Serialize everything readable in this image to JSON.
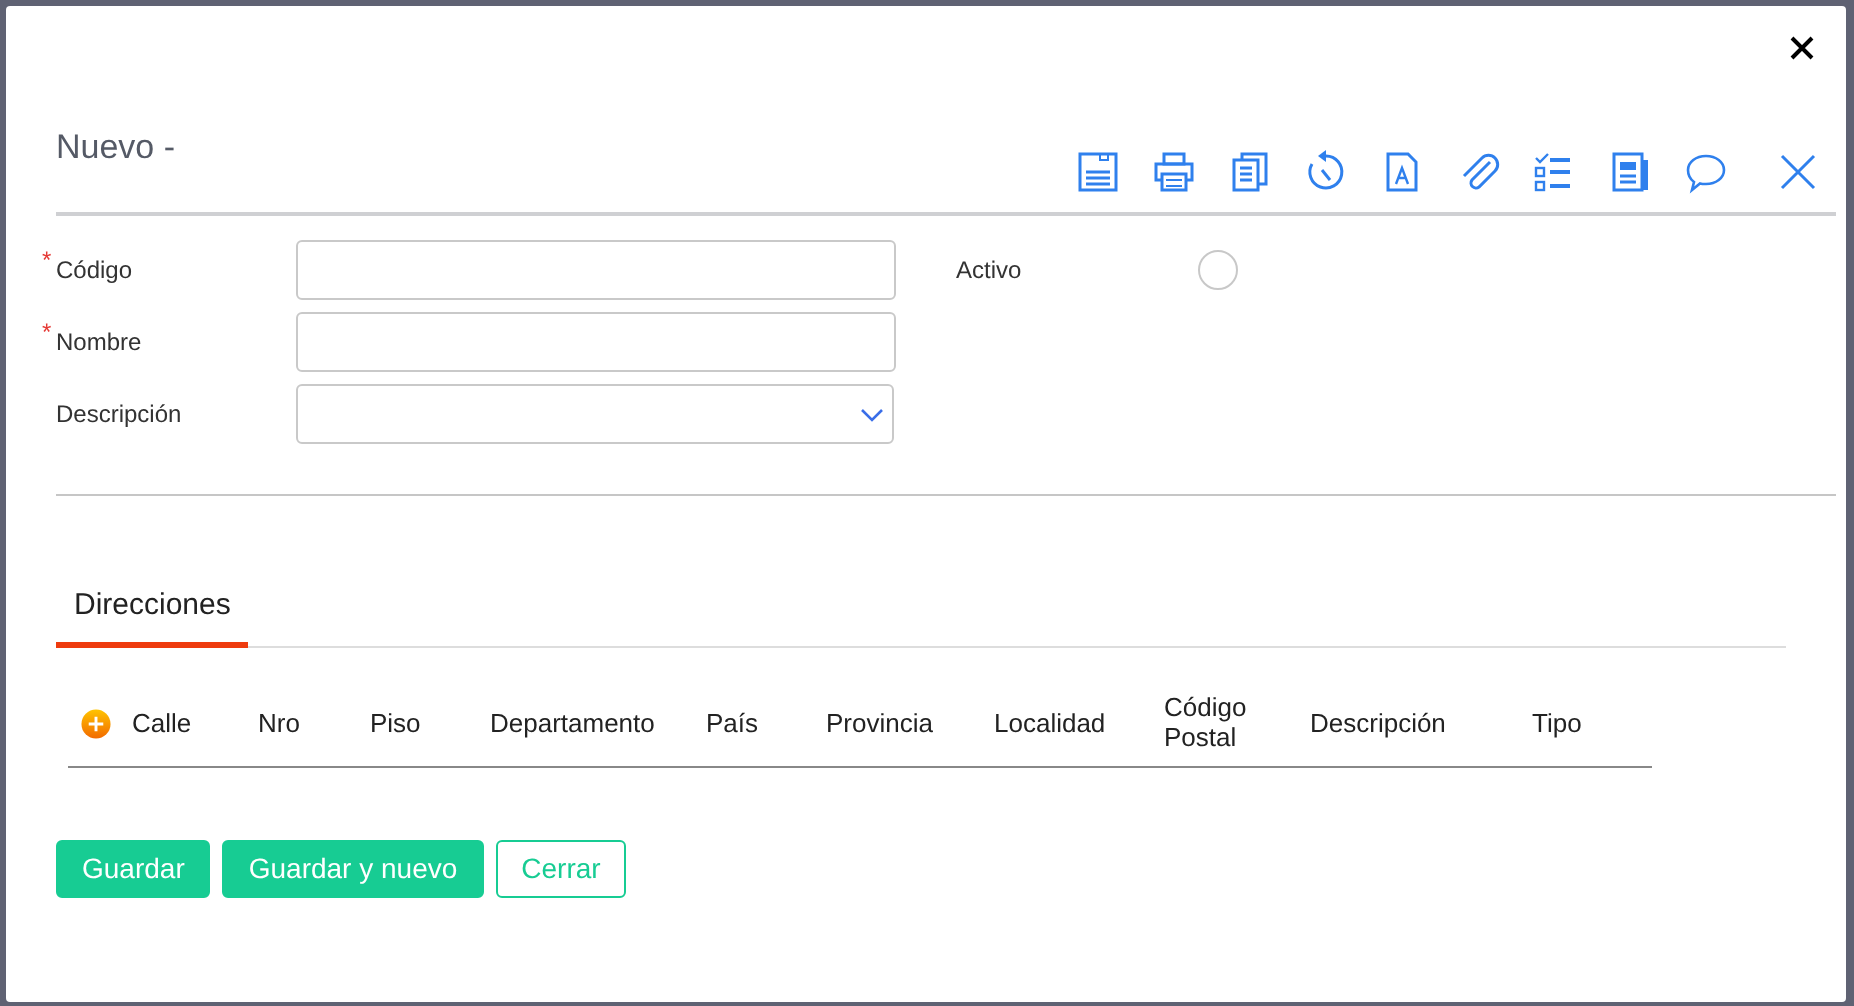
{
  "title": "Nuevo -",
  "required_marker": "*",
  "fields": [
    {
      "label": "Código",
      "required": true,
      "kind": "text"
    },
    {
      "label": "Nombre",
      "required": true,
      "kind": "text"
    },
    {
      "label": "Descripción",
      "required": false,
      "kind": "select"
    }
  ],
  "active": {
    "label": "Activo",
    "checked": false
  },
  "tabs": [
    {
      "label": "Direcciones",
      "selected": true
    }
  ],
  "table": {
    "columns": [
      "Calle",
      "Nro",
      "Piso",
      "Departamento",
      "País",
      "Provincia",
      "Localidad",
      "Código Postal",
      "Descripción",
      "Tipo"
    ]
  },
  "buttons": [
    {
      "label": "Guardar",
      "kind": "primary"
    },
    {
      "label": "Guardar y nuevo",
      "kind": "primary"
    },
    {
      "label": "Cerrar",
      "kind": "outline"
    }
  ]
}
